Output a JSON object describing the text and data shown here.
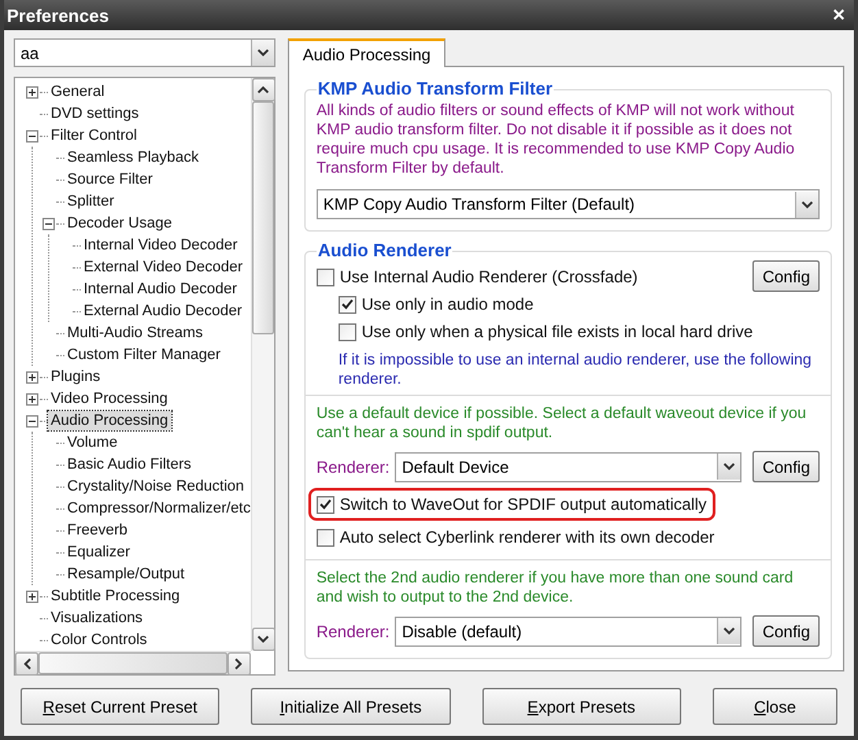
{
  "window": {
    "title": "Preferences",
    "close": "✕"
  },
  "preset_combo": {
    "value": "aa"
  },
  "tree": [
    {
      "label": "General",
      "expanded": false,
      "selected": false
    },
    {
      "label": "DVD settings",
      "selected": false
    },
    {
      "label": "Filter Control",
      "expanded": true,
      "selected": false,
      "children": [
        {
          "label": "Seamless Playback",
          "selected": false
        },
        {
          "label": "Source Filter",
          "selected": false
        },
        {
          "label": "Splitter",
          "selected": false
        },
        {
          "label": "Decoder Usage",
          "expanded": true,
          "selected": false,
          "children": [
            {
              "label": "Internal Video Decoder",
              "selected": false
            },
            {
              "label": "External Video Decoder",
              "selected": false
            },
            {
              "label": "Internal Audio Decoder",
              "selected": false
            },
            {
              "label": "External Audio Decoder",
              "selected": false
            }
          ]
        },
        {
          "label": "Multi-Audio Streams",
          "selected": false
        },
        {
          "label": "Custom Filter Manager",
          "selected": false
        }
      ]
    },
    {
      "label": "Plugins",
      "expanded": false,
      "selected": false
    },
    {
      "label": "Video Processing",
      "expanded": false,
      "selected": false
    },
    {
      "label": "Audio Processing",
      "expanded": true,
      "selected": true,
      "children": [
        {
          "label": "Volume",
          "selected": false
        },
        {
          "label": "Basic Audio Filters",
          "selected": false
        },
        {
          "label": "Crystality/Noise Reduction",
          "selected": false
        },
        {
          "label": "Compressor/Normalizer/etc",
          "selected": false
        },
        {
          "label": "Freeverb",
          "selected": false
        },
        {
          "label": "Equalizer",
          "selected": false
        },
        {
          "label": "Resample/Output",
          "selected": false
        }
      ]
    },
    {
      "label": "Subtitle Processing",
      "expanded": false,
      "selected": false
    },
    {
      "label": "Visualizations",
      "selected": false
    },
    {
      "label": "Color Controls",
      "selected": false
    }
  ],
  "tabs": [
    {
      "label": "Audio Processing",
      "selected": true
    }
  ],
  "transform_filter": {
    "title": "KMP Audio Transform Filter",
    "description": "All kinds of audio filters or sound effects of KMP will not work without KMP audio transform filter. Do not disable it if possible as it does not require much cpu usage. It is recommended to use KMP Copy Audio Transform Filter by default.",
    "value": "KMP Copy Audio Transform Filter (Default)"
  },
  "audio_renderer": {
    "title": "Audio Renderer",
    "internal": {
      "label": "Use Internal Audio Renderer (Crossfade)",
      "checked": false,
      "config": "Config",
      "children": [
        {
          "label": "Use only in audio mode",
          "checked": true
        },
        {
          "label": "Use only when a physical file exists in local hard drive",
          "checked": false
        }
      ]
    },
    "fallback_note": "If it is impossible to use an internal audio renderer, use the following renderer.",
    "primary": {
      "note": "Use a default device if possible. Select a default waveout device if you can't hear a sound in spdif output.",
      "renderer_label": "Renderer:",
      "value": "Default Device",
      "config": "Config",
      "options": [
        {
          "label": "Switch to WaveOut for SPDIF output automatically",
          "checked": true,
          "highlighted": true
        },
        {
          "label": "Auto select Cyberlink renderer with its own decoder",
          "checked": false,
          "highlighted": false
        }
      ]
    },
    "secondary": {
      "note": "Select the 2nd audio renderer if you have more than one sound card and wish to output to the 2nd device.",
      "renderer_label": "Renderer:",
      "value": "Disable (default)",
      "config": "Config"
    }
  },
  "buttons": [
    {
      "accel": "R",
      "rest": "eset Current Preset"
    },
    {
      "accel": "I",
      "rest": "nitialize All Presets"
    },
    {
      "accel": "E",
      "rest": "xport Presets"
    }
  ],
  "close_button": {
    "accel": "C",
    "rest": "lose"
  }
}
